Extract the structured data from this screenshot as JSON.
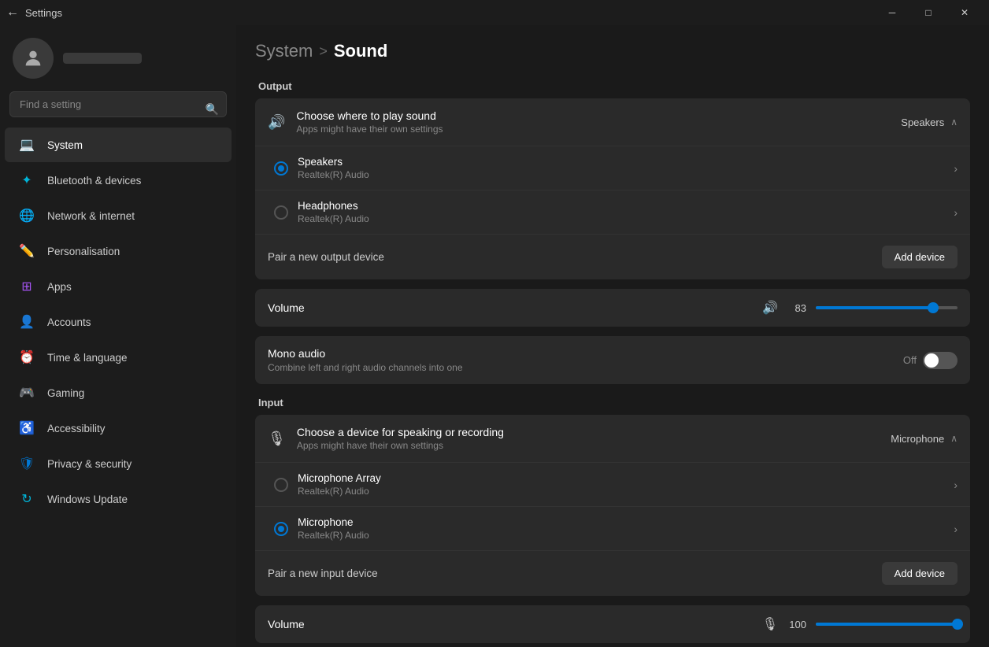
{
  "titleBar": {
    "appName": "Settings",
    "backArrow": "←",
    "minBtn": "─",
    "maxBtn": "□",
    "closeBtn": "✕"
  },
  "sidebar": {
    "searchPlaceholder": "Find a setting",
    "searchIcon": "🔍",
    "navItems": [
      {
        "id": "system",
        "label": "System",
        "icon": "💻",
        "iconClass": "blue",
        "active": true
      },
      {
        "id": "bluetooth",
        "label": "Bluetooth & devices",
        "icon": "✦",
        "iconClass": "cyan"
      },
      {
        "id": "network",
        "label": "Network & internet",
        "icon": "🌐",
        "iconClass": "teal"
      },
      {
        "id": "personalisation",
        "label": "Personalisation",
        "icon": "✏️",
        "iconClass": "blue"
      },
      {
        "id": "apps",
        "label": "Apps",
        "icon": "⊞",
        "iconClass": "purple"
      },
      {
        "id": "accounts",
        "label": "Accounts",
        "icon": "👤",
        "iconClass": "orange"
      },
      {
        "id": "time",
        "label": "Time & language",
        "icon": "⏰",
        "iconClass": "cyan"
      },
      {
        "id": "gaming",
        "label": "Gaming",
        "icon": "🎮",
        "iconClass": "green"
      },
      {
        "id": "accessibility",
        "label": "Accessibility",
        "icon": "♿",
        "iconClass": "accent"
      },
      {
        "id": "privacy",
        "label": "Privacy & security",
        "icon": "🛡",
        "iconClass": "blue"
      },
      {
        "id": "update",
        "label": "Windows Update",
        "icon": "↻",
        "iconClass": "cyan"
      }
    ]
  },
  "header": {
    "parent": "System",
    "separator": ">",
    "title": "Sound"
  },
  "output": {
    "sectionLabel": "Output",
    "chooseDevice": {
      "title": "Choose where to play sound",
      "subtitle": "Apps might have their own settings",
      "selected": "Speakers",
      "chevron": "∧"
    },
    "devices": [
      {
        "name": "Speakers",
        "sub": "Realtek(R) Audio",
        "selected": true,
        "hasRedArrow": false
      },
      {
        "name": "Headphones",
        "sub": "Realtek(R) Audio",
        "selected": false,
        "hasRedArrow": true
      }
    ],
    "pairLabel": "Pair a new output device",
    "addDeviceLabel": "Add device",
    "volume": {
      "label": "Volume",
      "value": "83",
      "fillPercent": 83,
      "thumbPos": 83
    },
    "monoAudio": {
      "title": "Mono audio",
      "subtitle": "Combine left and right audio channels into one",
      "toggleState": "off",
      "toggleLabel": "Off"
    }
  },
  "input": {
    "sectionLabel": "Input",
    "chooseDevice": {
      "title": "Choose a device for speaking or recording",
      "subtitle": "Apps might have their own settings",
      "selected": "Microphone",
      "chevron": "∧"
    },
    "devices": [
      {
        "name": "Microphone Array",
        "sub": "Realtek(R) Audio",
        "selected": false
      },
      {
        "name": "Microphone",
        "sub": "Realtek(R) Audio",
        "selected": true
      }
    ],
    "pairLabel": "Pair a new input device",
    "addDeviceLabel": "Add device",
    "volume": {
      "label": "Volume",
      "value": "100",
      "fillPercent": 100,
      "thumbPos": 100
    }
  }
}
